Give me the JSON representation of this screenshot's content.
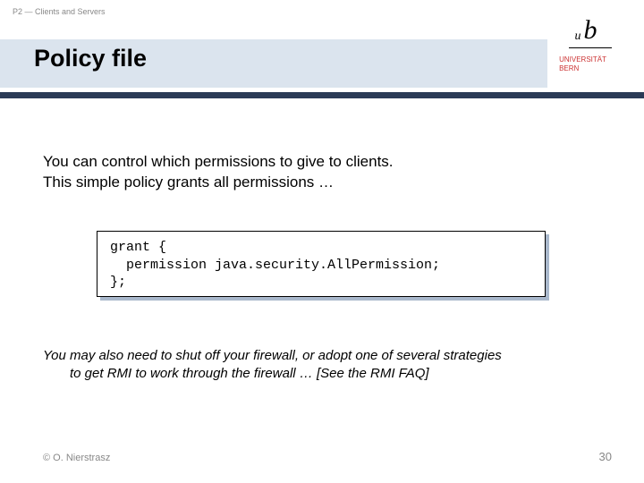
{
  "breadcrumb": "P2 — Clients and Servers",
  "title": "Policy file",
  "university": {
    "line1": "UNIVERSITÄT",
    "line2": "BERN"
  },
  "body": {
    "p1_line1": "You can control which permissions to give to clients.",
    "p1_line2": "This simple policy grants all permissions …",
    "code": "grant {\n  permission java.security.AllPermission;\n};",
    "p2_line1": "You may also need to shut off your firewall, or adopt one of several strategies",
    "p2_line2": "to get RMI to work through the firewall … [See the RMI FAQ]"
  },
  "footer": {
    "copyright": "© O. Nierstrasz",
    "page": "30"
  }
}
